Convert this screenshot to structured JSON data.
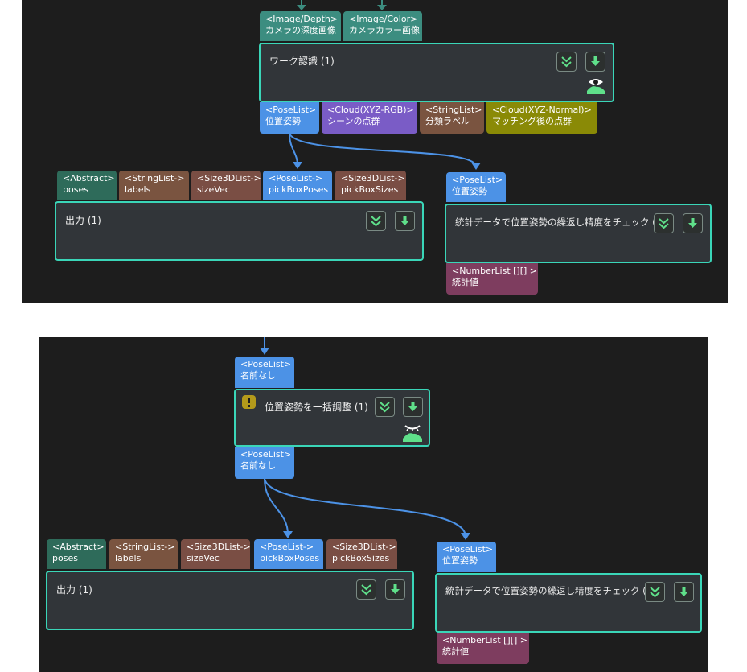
{
  "top": {
    "inputs": [
      {
        "type": "<Image/Depth>",
        "name": "カメラの深度画像"
      },
      {
        "type": "<Image/Color>",
        "name": "カメラカラー画像"
      }
    ],
    "recognition": {
      "title": "ワーク認識 (1)"
    },
    "outputs": [
      {
        "type": "<PoseList>",
        "name": "位置姿勢"
      },
      {
        "type": "<Cloud(XYZ-RGB)>",
        "name": "シーンの点群"
      },
      {
        "type": "<StringList>",
        "name": "分類ラベル"
      },
      {
        "type": "<Cloud(XYZ-Normal)>",
        "name": "マッチング後の点群"
      }
    ],
    "output_node": {
      "title": "出力 (1)",
      "inputs": [
        {
          "type": "<Abstract>",
          "name": "poses"
        },
        {
          "type": "<StringList->",
          "name": "labels"
        },
        {
          "type": "<Size3DList->",
          "name": "sizeVec"
        },
        {
          "type": "<PoseList->",
          "name": "pickBoxPoses"
        },
        {
          "type": "<Size3DList->",
          "name": "pickBoxSizes"
        }
      ]
    },
    "check_node": {
      "title": "統計データで位置姿勢の繰返し精度をチェック (1)",
      "input": {
        "type": "<PoseList>",
        "name": "位置姿勢"
      },
      "output": {
        "type": "<NumberList [][] >",
        "name": "統計値"
      }
    }
  },
  "bottom": {
    "adjust_node": {
      "title": "位置姿勢を一括調整 (1)",
      "input": {
        "type": "<PoseList>",
        "name": "名前なし"
      },
      "output": {
        "type": "<PoseList>",
        "name": "名前なし"
      }
    },
    "output_node": {
      "title": "出力 (1)",
      "inputs": [
        {
          "type": "<Abstract>",
          "name": "poses"
        },
        {
          "type": "<StringList->",
          "name": "labels"
        },
        {
          "type": "<Size3DList->",
          "name": "sizeVec"
        },
        {
          "type": "<PoseList->",
          "name": "pickBoxPoses"
        },
        {
          "type": "<Size3DList->",
          "name": "pickBoxSizes"
        }
      ]
    },
    "check_node": {
      "title": "統計データで位置姿勢の繰返し精度をチェック (1)",
      "input": {
        "type": "<PoseList>",
        "name": "位置姿勢"
      },
      "output": {
        "type": "<NumberList [][] >",
        "name": "統計値"
      }
    }
  },
  "colors": {
    "canvas": "#1d1d1d",
    "node_body": "#313539",
    "node_border": "#3ad6b8",
    "wire": "#4c92e6",
    "button_icon": "#5fe08a"
  },
  "icons": [
    "collapse-icon",
    "download-icon",
    "eye-icon",
    "eye-closed-icon",
    "warning-icon"
  ]
}
